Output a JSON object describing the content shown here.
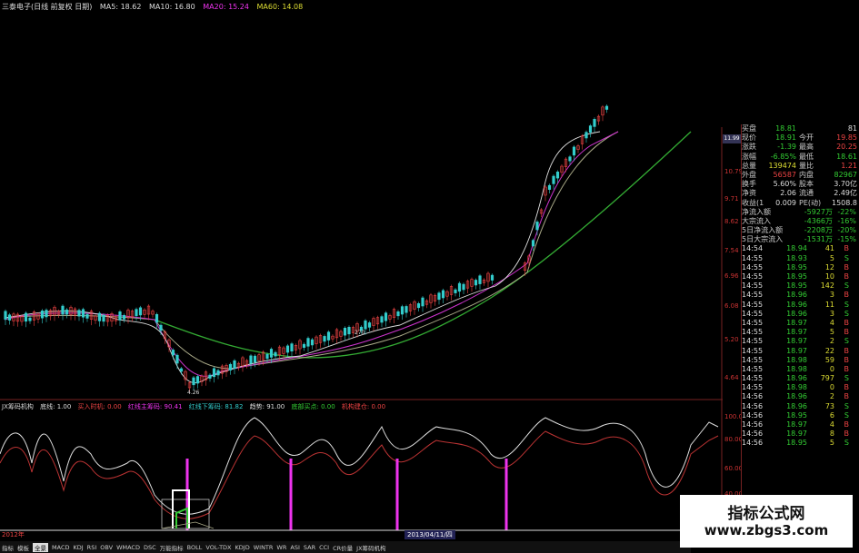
{
  "title_bar": {
    "stock_name": "三泰电子(日线 前复权 日期)",
    "ma5": "MA5: 18.62",
    "ma10": "MA10: 16.80",
    "ma20": "MA20: 15.24",
    "ma60": "MA60: 14.08"
  },
  "chart_labels": {
    "peak_low": "4.26",
    "mid_mark": "270"
  },
  "right_axis": [
    "10.79",
    "9.71",
    "8.62",
    "7.54",
    "6.96",
    "6.08",
    "5.20",
    "4.64",
    "100.00",
    "80.00",
    "60.00",
    "40.00"
  ],
  "current_price_tag": "11.99",
  "quote_panel": {
    "summary": [
      {
        "l1": "买盘",
        "v1": "18.81",
        "l2": "",
        "v2": "81",
        "c1": "grn",
        "c2": "wht"
      },
      {
        "l1": "现价",
        "v1": "18.91",
        "l2": "今开",
        "v2": "19.85",
        "c1": "grn",
        "c2": "red"
      },
      {
        "l1": "涨跌",
        "v1": "-1.39",
        "l2": "最高",
        "v2": "20.25",
        "c1": "grn",
        "c2": "red"
      },
      {
        "l1": "涨幅",
        "v1": "-6.85%",
        "l2": "最低",
        "v2": "18.61",
        "c1": "grn",
        "c2": "grn"
      },
      {
        "l1": "总量",
        "v1": "139474",
        "l2": "量比",
        "v2": "1.21",
        "c1": "yel",
        "c2": "red"
      },
      {
        "l1": "外盘",
        "v1": "56587",
        "l2": "内盘",
        "v2": "82967",
        "c1": "red",
        "c2": "grn"
      },
      {
        "l1": "换手",
        "v1": "5.60%",
        "l2": "股本",
        "v2": "3.70亿",
        "c1": "wht",
        "c2": "wht"
      },
      {
        "l1": "净资",
        "v1": "2.06",
        "l2": "流通",
        "v2": "2.49亿",
        "c1": "wht",
        "c2": "wht"
      },
      {
        "l1": "收益(1)",
        "v1": "0.009",
        "l2": "PE(动)",
        "v2": "1508.8",
        "c1": "wht",
        "c2": "wht"
      }
    ],
    "flows": [
      {
        "label": "净流入额",
        "value": "-5927万",
        "pct": "-22%"
      },
      {
        "label": "大宗流入",
        "value": "-4366万",
        "pct": "-16%"
      },
      {
        "label": "5日净流入额",
        "value": "-2208万",
        "pct": "-20%"
      },
      {
        "label": "5日大宗流入",
        "value": "-1531万",
        "pct": "-15%"
      }
    ],
    "ticks": [
      {
        "t": "14:54",
        "p": "18.94",
        "v": "41",
        "d": "B"
      },
      {
        "t": "14:55",
        "p": "18.93",
        "v": "5",
        "d": "S"
      },
      {
        "t": "14:55",
        "p": "18.95",
        "v": "12",
        "d": "B"
      },
      {
        "t": "14:55",
        "p": "18.95",
        "v": "10",
        "d": "B"
      },
      {
        "t": "14:55",
        "p": "18.95",
        "v": "142",
        "d": "S"
      },
      {
        "t": "14:55",
        "p": "18.96",
        "v": "3",
        "d": "B"
      },
      {
        "t": "14:55",
        "p": "18.96",
        "v": "11",
        "d": "S"
      },
      {
        "t": "14:55",
        "p": "18.96",
        "v": "3",
        "d": "S"
      },
      {
        "t": "14:55",
        "p": "18.97",
        "v": "4",
        "d": "B"
      },
      {
        "t": "14:55",
        "p": "18.97",
        "v": "5",
        "d": "B"
      },
      {
        "t": "14:55",
        "p": "18.97",
        "v": "2",
        "d": "S"
      },
      {
        "t": "14:55",
        "p": "18.97",
        "v": "22",
        "d": "B"
      },
      {
        "t": "14:55",
        "p": "18.98",
        "v": "59",
        "d": "B"
      },
      {
        "t": "14:55",
        "p": "18.98",
        "v": "0",
        "d": "B"
      },
      {
        "t": "14:55",
        "p": "18.96",
        "v": "797",
        "d": "S"
      },
      {
        "t": "14:55",
        "p": "18.98",
        "v": "0",
        "d": "B"
      },
      {
        "t": "14:56",
        "p": "18.96",
        "v": "2",
        "d": "B"
      },
      {
        "t": "14:56",
        "p": "18.96",
        "v": "73",
        "d": "S"
      },
      {
        "t": "14:56",
        "p": "18.95",
        "v": "6",
        "d": "S"
      },
      {
        "t": "14:56",
        "p": "18.97",
        "v": "4",
        "d": "B"
      },
      {
        "t": "14:56",
        "p": "18.97",
        "v": "8",
        "d": "B"
      },
      {
        "t": "14:56",
        "p": "18.95",
        "v": "5",
        "d": "S"
      }
    ]
  },
  "indicator_bar": {
    "name": "JX筹码机构",
    "item1": "底线: 1.00",
    "item2": "买入时机: 0.00",
    "item3": "红线主筹码: 90.41",
    "item4": "红线下筹码: 81.82",
    "item5": "趋势: 91.00",
    "item6": "底部买点: 0.00",
    "item7": "机构建仓: 0.00"
  },
  "date_axis": {
    "start": "2012年",
    "highlight": "2013/04/11/四"
  },
  "bottom_tabs": [
    "指标",
    "模板",
    "全景",
    "MACD",
    "KDJ",
    "RSI",
    "OBV",
    "WMACD",
    "DSC",
    "万能指标",
    "BOLL",
    "VOL-TDX",
    "KDJD",
    "WINTR",
    "WR",
    "ASI",
    "SAR",
    "CCI",
    "CR价量",
    "JX筹码机构"
  ],
  "watermark": {
    "line1": "指标公式网",
    "line2": "www.zbgs3.com"
  },
  "colors": {
    "up": "#e44",
    "down": "#3c3",
    "ma5": "#ddd",
    "ma10": "#e3e",
    "ma20": "#dd3",
    "ma60": "#3a3"
  }
}
